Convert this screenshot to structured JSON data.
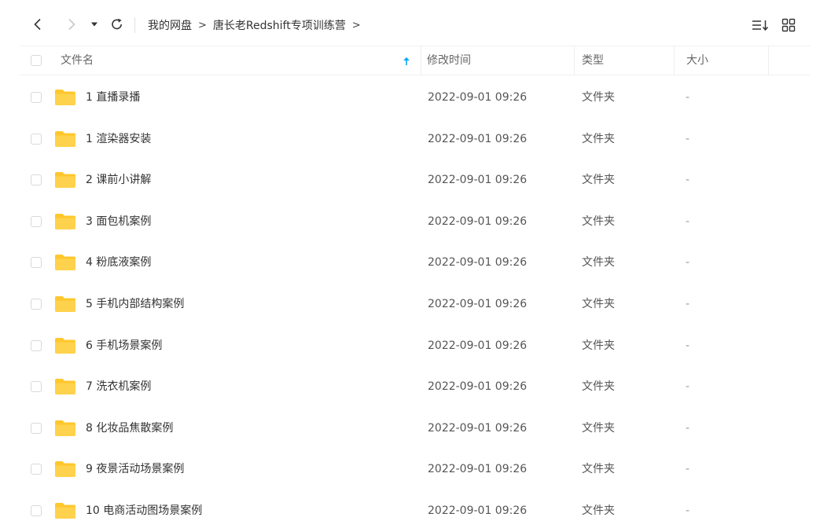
{
  "nav": {
    "back_icon": "chevron-left-icon",
    "forward_icon": "chevron-right-icon",
    "dropdown_icon": "caret-down-icon",
    "refresh_icon": "refresh-icon",
    "sort_icon": "sort-list-icon",
    "grid_icon": "grid-view-icon"
  },
  "breadcrumb": {
    "root": "我的网盘",
    "current": "唐长老Redshift专项训练营",
    "separator": ">"
  },
  "columns": {
    "name": "文件名",
    "modified": "修改时间",
    "type": "类型",
    "size": "大小"
  },
  "colors": {
    "folder": "#FFC72C",
    "accent": "#06A7FF",
    "text": "#333333"
  },
  "files": [
    {
      "name": "1  直播录播",
      "modified": "2022-09-01 09:26",
      "type": "文件夹",
      "size": "-"
    },
    {
      "name": "1 渲染器安装",
      "modified": "2022-09-01 09:26",
      "type": "文件夹",
      "size": "-"
    },
    {
      "name": "2 课前小讲解",
      "modified": "2022-09-01 09:26",
      "type": "文件夹",
      "size": "-"
    },
    {
      "name": "3 面包机案例",
      "modified": "2022-09-01 09:26",
      "type": "文件夹",
      "size": "-"
    },
    {
      "name": "4 粉底液案例",
      "modified": "2022-09-01 09:26",
      "type": "文件夹",
      "size": "-"
    },
    {
      "name": "5 手机内部结构案例",
      "modified": "2022-09-01 09:26",
      "type": "文件夹",
      "size": "-"
    },
    {
      "name": "6 手机场景案例",
      "modified": "2022-09-01 09:26",
      "type": "文件夹",
      "size": "-"
    },
    {
      "name": "7 洗衣机案例",
      "modified": "2022-09-01 09:26",
      "type": "文件夹",
      "size": "-"
    },
    {
      "name": "8 化妆品焦散案例",
      "modified": "2022-09-01 09:26",
      "type": "文件夹",
      "size": "-"
    },
    {
      "name": "9 夜景活动场景案例",
      "modified": "2022-09-01 09:26",
      "type": "文件夹",
      "size": "-"
    },
    {
      "name": "10 电商活动图场景案例",
      "modified": "2022-09-01 09:26",
      "type": "文件夹",
      "size": "-"
    }
  ]
}
